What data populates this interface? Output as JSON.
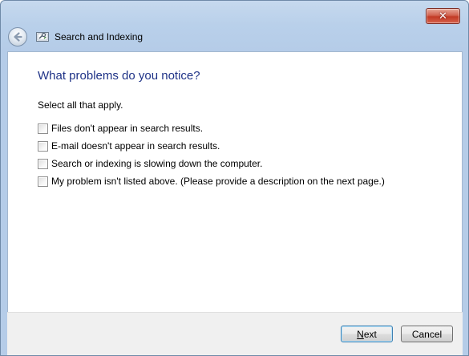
{
  "window": {
    "title": "Search and Indexing",
    "close_label": "✕"
  },
  "page": {
    "heading": "What problems do you notice?",
    "instruction": "Select all that apply.",
    "options": [
      {
        "label": "Files don't appear in search results.",
        "checked": false
      },
      {
        "label": "E-mail doesn't appear in search results.",
        "checked": false
      },
      {
        "label": "Search or indexing is slowing down the computer.",
        "checked": false
      },
      {
        "label": "My problem isn't listed above. (Please provide a description on the next page.)",
        "checked": false
      }
    ]
  },
  "footer": {
    "next_mnemonic": "N",
    "next_rest": "ext",
    "cancel_label": "Cancel"
  },
  "colors": {
    "heading": "#1e3287",
    "titlebar": "#b9d0ea",
    "footer": "#f0f0f0"
  },
  "icons": {
    "back": "back-arrow-icon",
    "app": "troubleshooter-icon",
    "close": "close-icon"
  }
}
